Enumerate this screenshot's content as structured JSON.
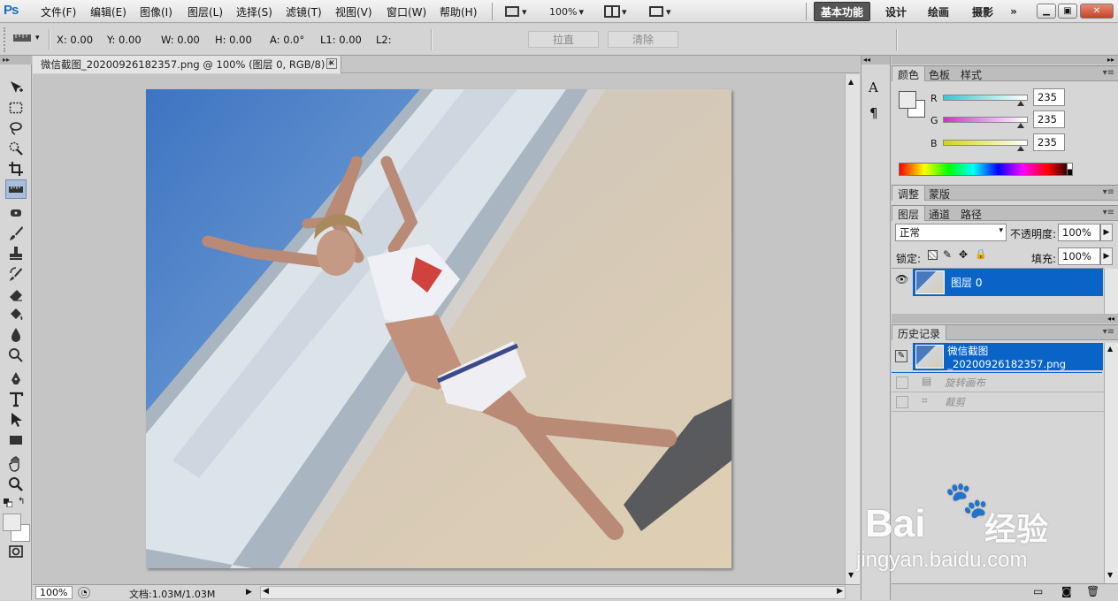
{
  "app": {
    "logo": "Ps"
  },
  "menu": {
    "items": [
      "文件(F)",
      "编辑(E)",
      "图像(I)",
      "图层(L)",
      "选择(S)",
      "滤镜(T)",
      "视图(V)",
      "窗口(W)",
      "帮助(H)"
    ],
    "zoom": "100%",
    "workspaces": [
      "基本功能",
      "设计",
      "绘画",
      "摄影"
    ],
    "more": "»"
  },
  "options": {
    "x": "X: 0.00",
    "y": "Y: 0.00",
    "w": "W: 0.00",
    "h": "H: 0.00",
    "a": "A: 0.0°",
    "l1": "L1: 0.00",
    "l2": "L2:",
    "straighten": "拉直",
    "clear": "清除"
  },
  "document": {
    "tab_title": "微信截图_20200926182357.png @ 100% (图层 0, RGB/8) *",
    "status_zoom": "100%",
    "status_doc": "文档:1.03M/1.03M"
  },
  "color_panel": {
    "tabs": [
      "颜色",
      "色板",
      "样式"
    ],
    "channels": [
      {
        "label": "R",
        "value": "235",
        "fraction": 0.92,
        "color_from": "#38c8d2",
        "color_to": "#ffffff"
      },
      {
        "label": "G",
        "value": "235",
        "fraction": 0.92,
        "color_from": "#cc33cc",
        "color_to": "#ffffff"
      },
      {
        "label": "B",
        "value": "235",
        "fraction": 0.92,
        "color_from": "#d4d414",
        "color_to": "#ffffff"
      }
    ]
  },
  "adjust_panel": {
    "tabs": [
      "调整",
      "蒙版"
    ]
  },
  "layers_panel": {
    "tabs": [
      "图层",
      "通道",
      "路径"
    ],
    "blend_mode": "正常",
    "opacity_label": "不透明度:",
    "opacity": "100%",
    "lock_label": "锁定:",
    "fill_label": "填充:",
    "fill": "100%",
    "layer_name": "图层 0"
  },
  "history_panel": {
    "tabs": [
      "历史记录"
    ],
    "snapshot": "微信截图_20200926182357.png",
    "items": [
      "旋转画布",
      "裁剪"
    ]
  },
  "watermark": {
    "brand": "Bai",
    "brand_cn": "经验",
    "url": "jingyan.baidu.com"
  },
  "colors": {
    "accent": "#0a64c8",
    "menu_bg": "#e6e6e6"
  }
}
